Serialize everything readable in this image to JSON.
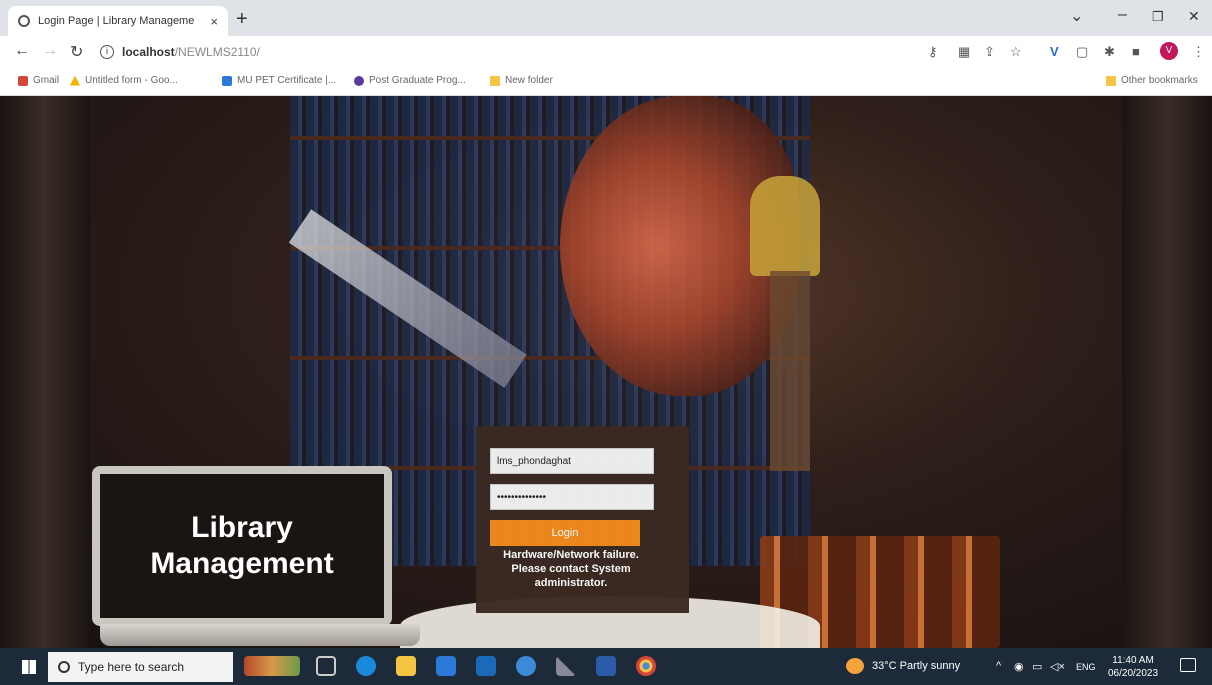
{
  "browser": {
    "tab_title": "Login Page | Library Manageme",
    "tab_close": "×",
    "new_tab": "+",
    "url_host": "localhost",
    "url_path": "/NEWLMS2110/",
    "win_min": "–",
    "win_restore": "❐",
    "win_close": "✕",
    "chevron": "⌄",
    "back": "←",
    "forward": "→",
    "reload": "↻",
    "profile_initial": "V"
  },
  "bookmarks": {
    "items": [
      "Gmail",
      "Untitled form - Goo...",
      "MU PET Certificate |...",
      "Post Graduate Prog...",
      "New folder"
    ],
    "other": "Other bookmarks"
  },
  "page": {
    "laptop_title_line1": "Library",
    "laptop_title_line2": "Management",
    "login": {
      "username_value": "lms_phondaghat",
      "password_value": "••••••••••••••",
      "button_label": "Login",
      "error_message": "Hardware/Network failure. Please contact System administrator."
    }
  },
  "taskbar": {
    "search_placeholder": "Type here to search",
    "weather": "33°C  Partly sunny",
    "lang": "ENG",
    "time": "11:40 AM",
    "date": "06/20/2023"
  },
  "colors": {
    "accent": "#f18a1c",
    "panel": "#3b2a22",
    "taskbar": "#1c2a3a"
  }
}
